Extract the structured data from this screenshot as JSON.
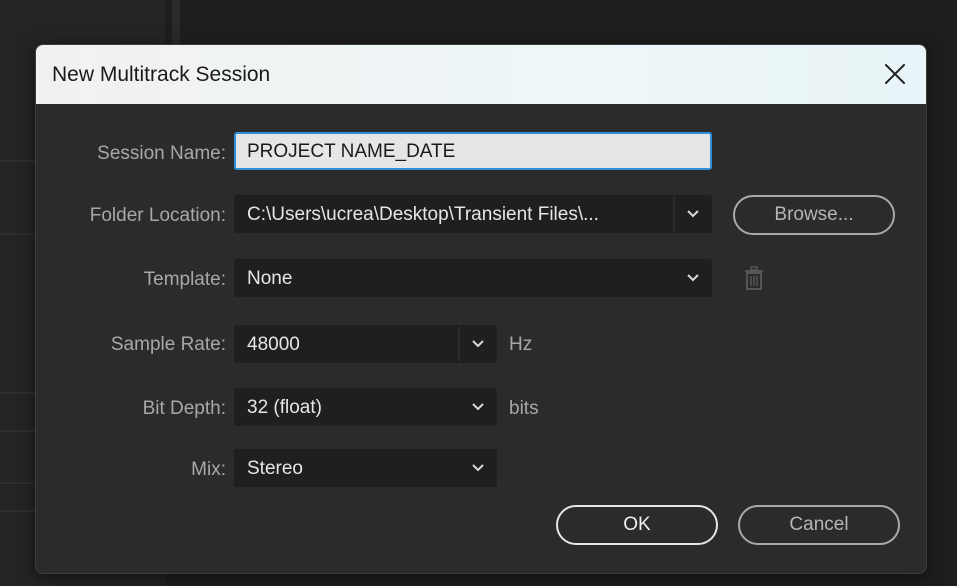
{
  "dialog": {
    "title": "New Multitrack Session",
    "close_icon": "close-icon"
  },
  "fields": {
    "session_name": {
      "label": "Session Name:",
      "value": "PROJECT NAME_DATE"
    },
    "folder_location": {
      "label": "Folder Location:",
      "value": "C:\\Users\\ucrea\\Desktop\\Transient Files\\..."
    },
    "template": {
      "label": "Template:",
      "value": "None"
    },
    "sample_rate": {
      "label": "Sample Rate:",
      "value": "48000",
      "unit": "Hz"
    },
    "bit_depth": {
      "label": "Bit Depth:",
      "value": "32 (float)",
      "unit": "bits"
    },
    "mix": {
      "label": "Mix:",
      "value": "Stereo"
    }
  },
  "buttons": {
    "browse": "Browse...",
    "ok": "OK",
    "cancel": "Cancel"
  },
  "icons": {
    "delete_template": "trash-icon",
    "dropdown": "chevron-down-icon"
  },
  "colors": {
    "focus_border": "#2f8fd8",
    "dialog_bg": "#2b2b2b",
    "field_bg": "#1f1f1f"
  }
}
